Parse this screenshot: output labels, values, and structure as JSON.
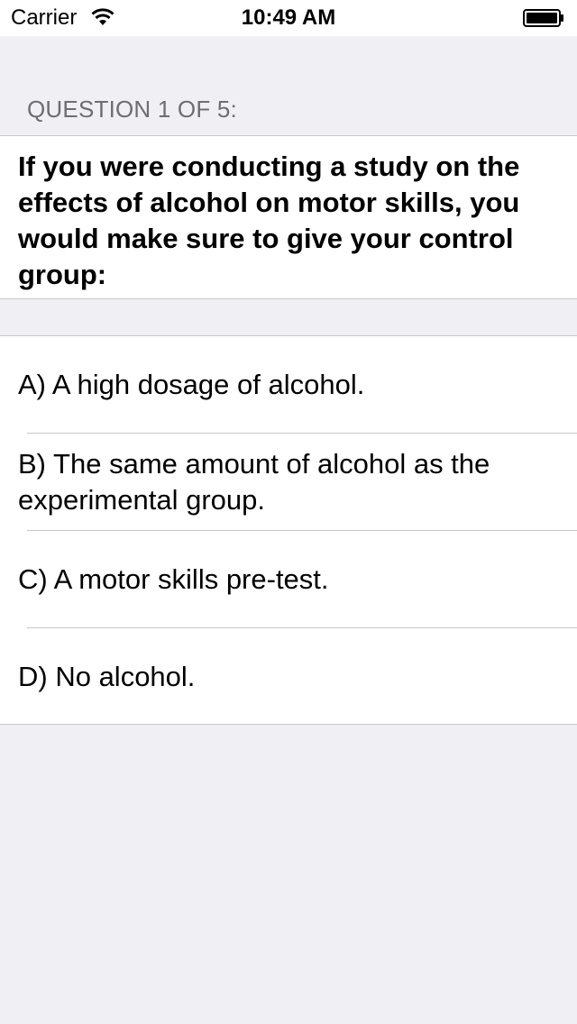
{
  "status_bar": {
    "carrier": "Carrier",
    "time": "10:49 AM"
  },
  "question": {
    "header": "QUESTION 1 OF 5:",
    "text": "If you were conducting a study on the effects of alcohol on motor skills, you would make sure to give your control group:"
  },
  "answers": [
    {
      "label": "A) A high dosage of alcohol."
    },
    {
      "label": "B) The same amount of alcohol as the experimental group."
    },
    {
      "label": "C) A motor skills pre-test."
    },
    {
      "label": "D) No alcohol."
    }
  ],
  "colors": {
    "background": "#efeff4",
    "card": "#ffffff",
    "separator": "#c8c7cc",
    "header_text": "#6d6d72"
  }
}
